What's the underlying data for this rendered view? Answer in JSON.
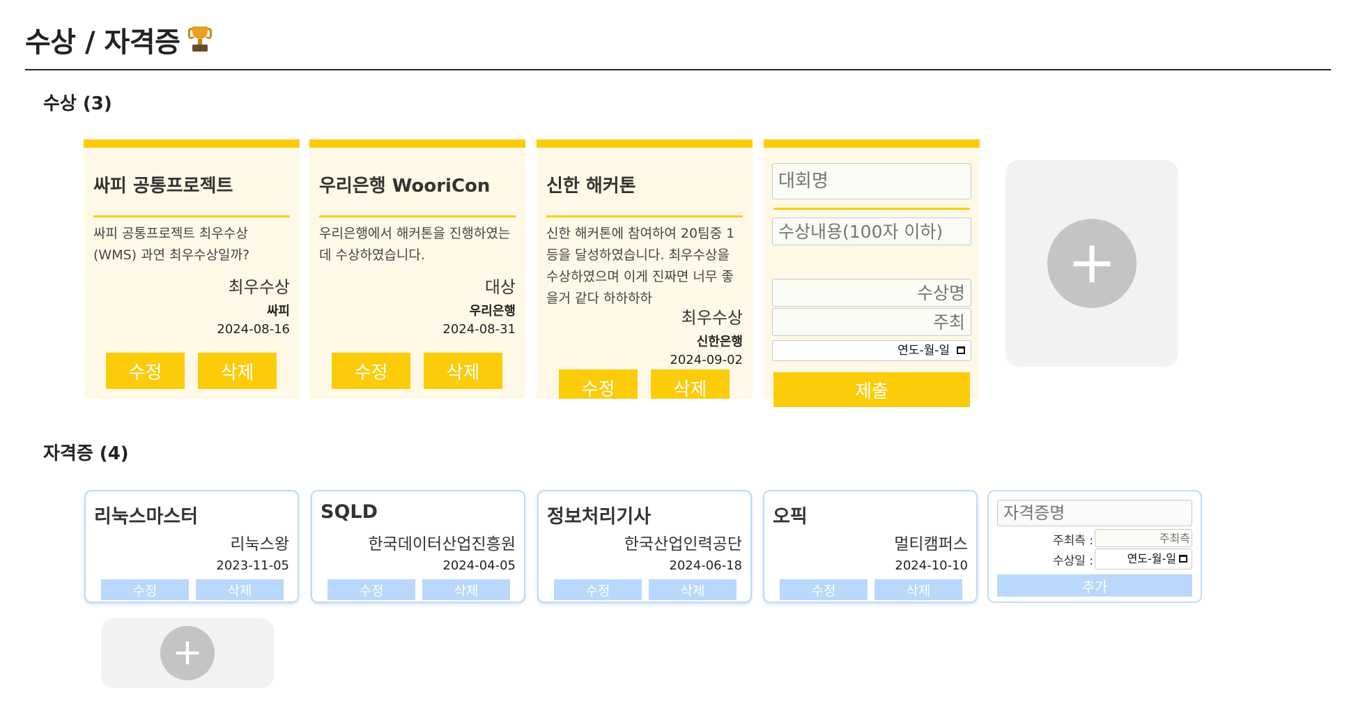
{
  "header": {
    "title": "수상 / 자격증"
  },
  "awards_section": {
    "title": "수상 (3)",
    "cards": [
      {
        "title": "싸피 공통프로젝트",
        "description": "싸피 공통프로젝트 최우수상 (WMS) 과연 최우수상일까?",
        "prize": "최우수상",
        "organizer": "싸피",
        "date": "2024-08-16",
        "edit_label": "수정",
        "delete_label": "삭제"
      },
      {
        "title": "우리은행 WooriCon",
        "description": "우리은행에서 해커톤을 진행하였는데 수상하였습니다.",
        "prize": "대상",
        "organizer": "우리은행",
        "date": "2024-08-31",
        "edit_label": "수정",
        "delete_label": "삭제"
      },
      {
        "title": "신한 해커톤",
        "description": "신한 해커톤에 참여하여 20팀중 1등을 달성하였습니다. 최우수상을 수상하였으며 이게 진짜면 너무 좋을거 같다 하하하하",
        "prize": "최우수상",
        "organizer": "신한은행",
        "date": "2024-09-02",
        "edit_label": "수정",
        "delete_label": "삭제"
      }
    ],
    "form": {
      "contest_placeholder": "대회명",
      "content_placeholder": "수상내용(100자 이하)",
      "award_name_placeholder": "수상명",
      "organizer_placeholder": "주최",
      "date_placeholder": "연도-월-일",
      "submit_label": "제출"
    },
    "add_icon": "plus-icon",
    "add_symbol": "+"
  },
  "certs_section": {
    "title": "자격증 (4)",
    "cards": [
      {
        "title": "리눅스마스터",
        "issuer": "리눅스왕",
        "date": "2023-11-05",
        "edit_label": "수정",
        "delete_label": "삭제"
      },
      {
        "title": "SQLD",
        "issuer": "한국데이터산업진흥원",
        "date": "2024-04-05",
        "edit_label": "수정",
        "delete_label": "삭제"
      },
      {
        "title": "정보처리기사",
        "issuer": "한국산업인력공단",
        "date": "2024-06-18",
        "edit_label": "수정",
        "delete_label": "삭제"
      },
      {
        "title": "오픽",
        "issuer": "멀티캠퍼스",
        "date": "2024-10-10",
        "edit_label": "수정",
        "delete_label": "삭제"
      }
    ],
    "form": {
      "name_placeholder": "자격증명",
      "issuer_label": "주최측 :",
      "issuer_placeholder": "주최측",
      "date_label": "수상일 :",
      "date_placeholder": "연도-월-일",
      "add_label": "추가"
    },
    "add_icon": "plus-icon",
    "add_symbol": "+"
  },
  "colors": {
    "award_accent": "#fccc0a",
    "award_bg": "#fdf9e6",
    "cert_accent": "#bad8fb",
    "cert_border": "#bfdaf5",
    "add_tile": "#f2f2f2",
    "add_circle": "#c4c4c4"
  }
}
